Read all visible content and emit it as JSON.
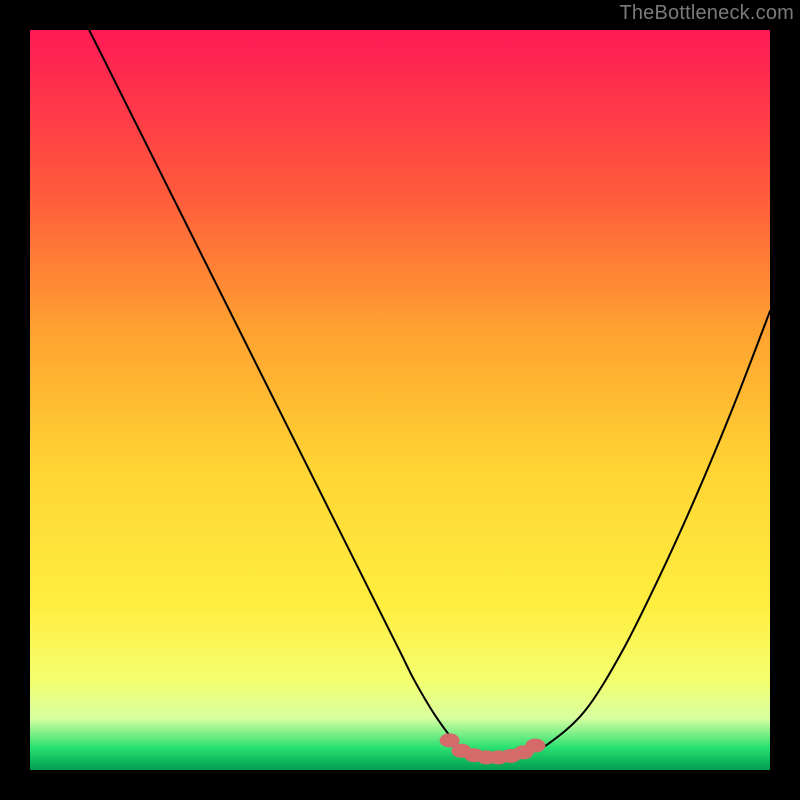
{
  "watermark": "TheBottleneck.com",
  "colors": {
    "page_bg": "#000000",
    "watermark": "#7a7a7a",
    "gradient_top": "#ff1a55",
    "gradient_upper": "#ff5a3c",
    "gradient_mid_upper": "#ffa030",
    "gradient_mid": "#ffd633",
    "gradient_mid_lower": "#ffee40",
    "gradient_lower": "#f4ff70",
    "gradient_band": "#d8ffa0",
    "gradient_bottom": "#28e070",
    "gradient_deep": "#009e50",
    "curve": "#000000",
    "marker_fill": "#d46a6a",
    "marker_stroke": "#c45555"
  },
  "chart_data": {
    "type": "line",
    "title": "",
    "xlabel": "",
    "ylabel": "",
    "xlim": [
      0,
      100
    ],
    "ylim": [
      0,
      100
    ],
    "series": [
      {
        "name": "bottleneck-curve",
        "x": [
          8,
          10,
          15,
          20,
          25,
          30,
          35,
          40,
          45,
          50,
          52,
          55,
          58,
          60,
          62,
          65,
          67,
          70,
          75,
          80,
          85,
          90,
          95,
          100
        ],
        "y": [
          100,
          96,
          86,
          76,
          66,
          56,
          46,
          36,
          26,
          16,
          12,
          7,
          3.2,
          2.2,
          1.8,
          1.8,
          2.2,
          3.5,
          8,
          16,
          26,
          37,
          49,
          62
        ]
      }
    ],
    "markers": {
      "name": "highlight-points",
      "x": [
        56.7,
        58.3,
        60.0,
        61.7,
        63.3,
        65.0,
        66.7,
        68.3
      ],
      "y": [
        4.0,
        2.6,
        2.0,
        1.7,
        1.7,
        1.9,
        2.4,
        3.3
      ]
    }
  }
}
